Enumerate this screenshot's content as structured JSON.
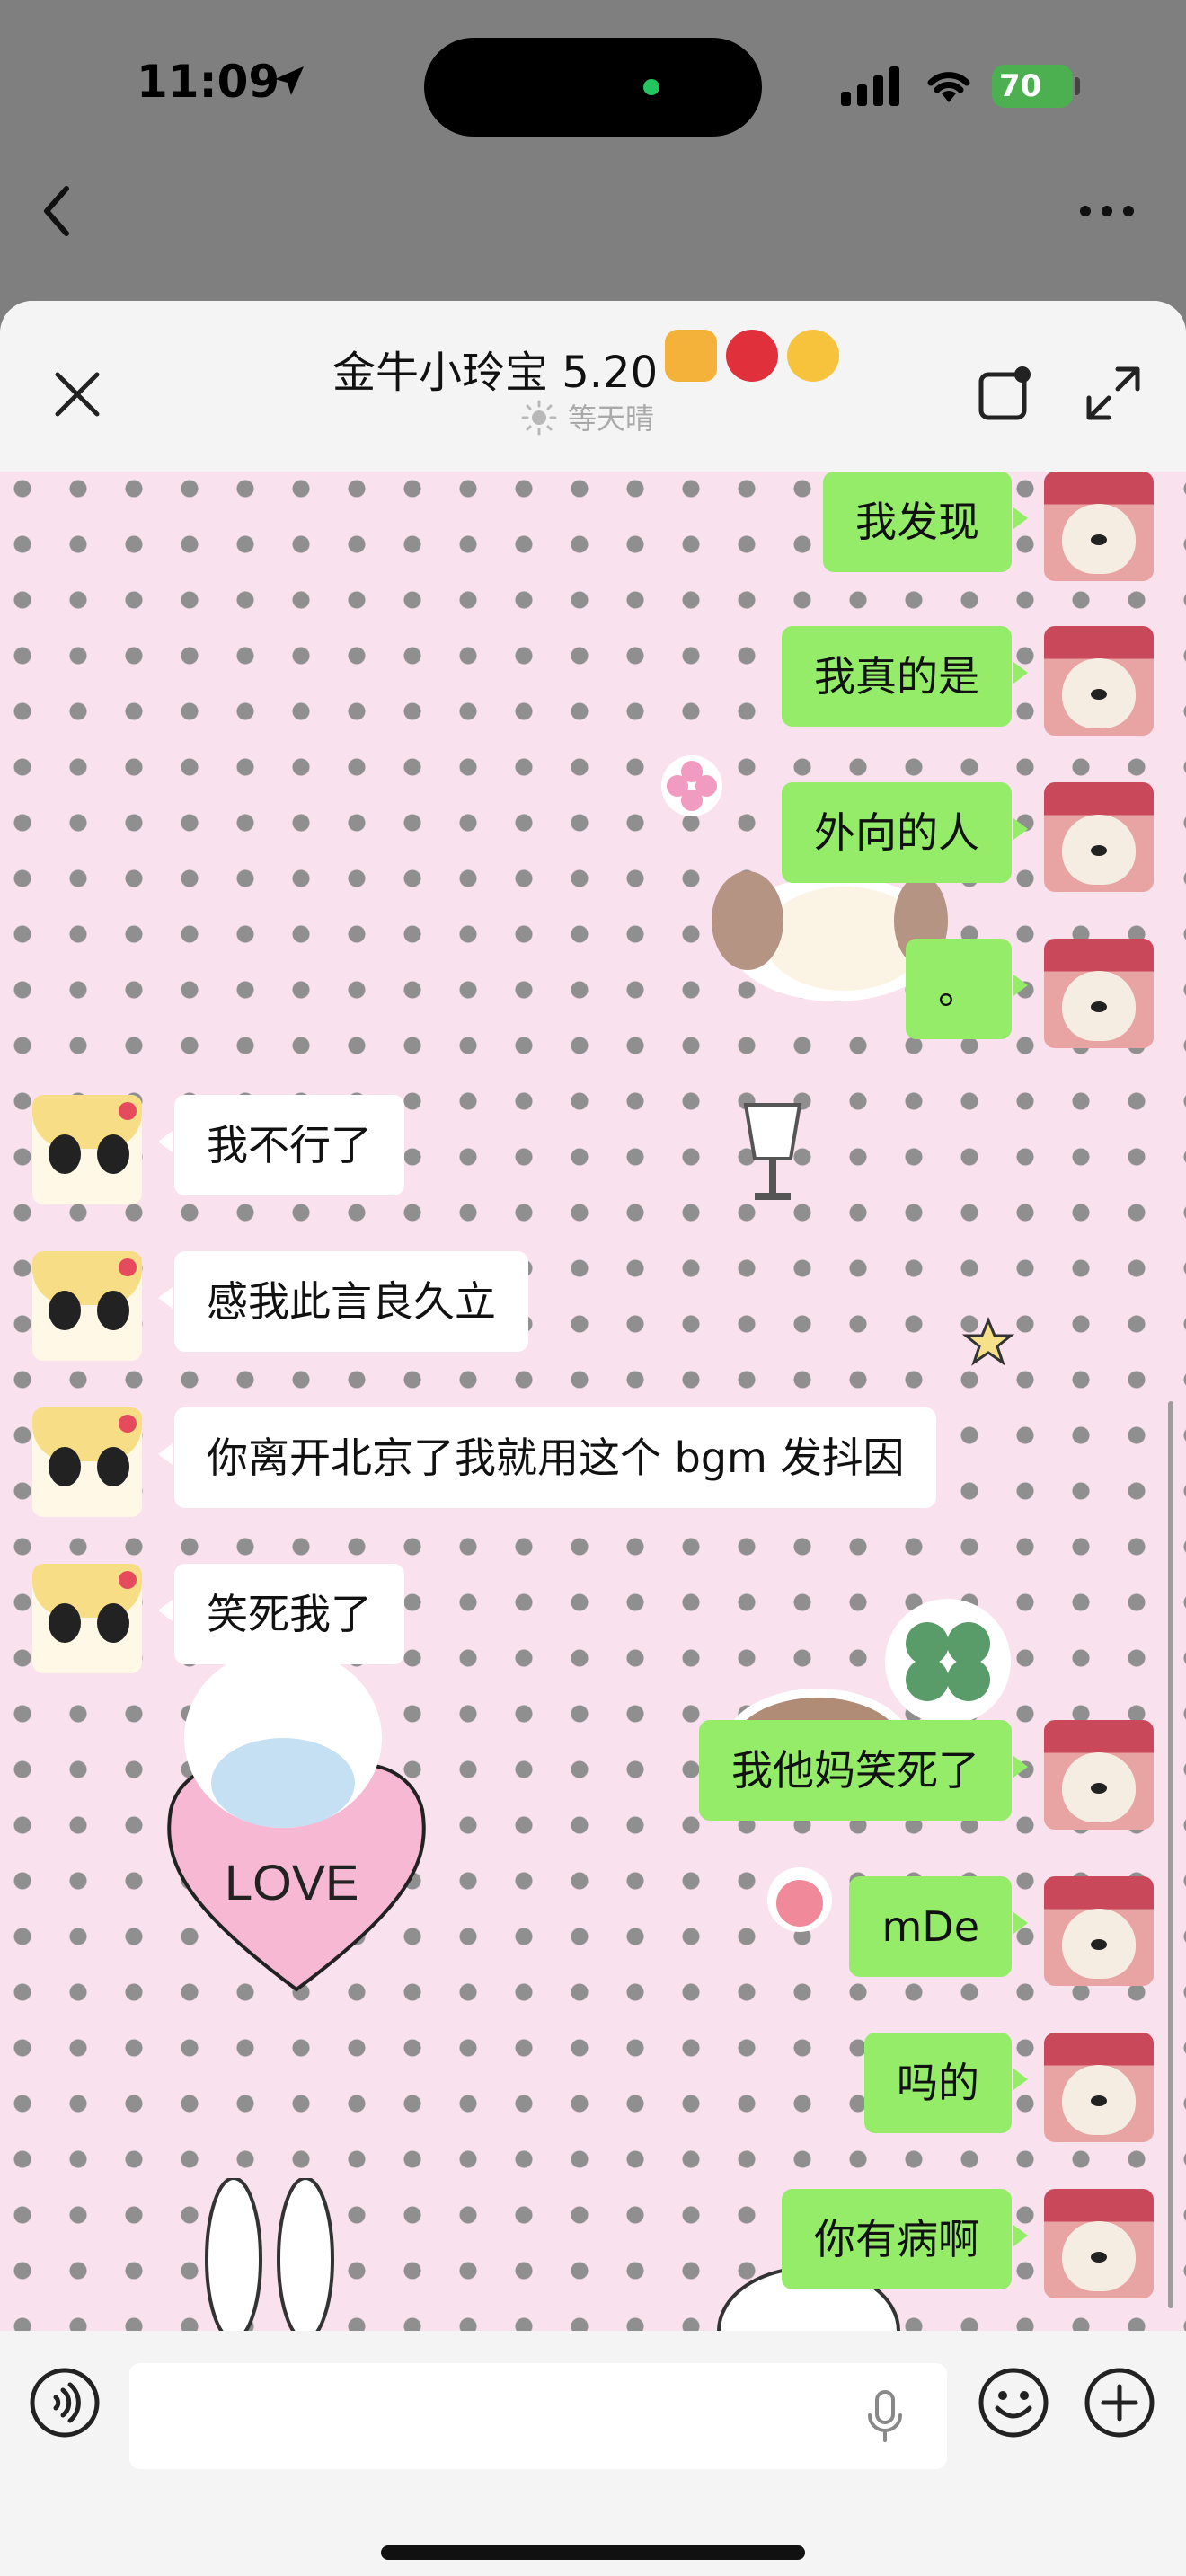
{
  "status_bar": {
    "time": "11:09",
    "battery": "70"
  },
  "header": {
    "title": "金牛小玲宝 5.20",
    "subtitle": "等天晴"
  },
  "messages": [
    {
      "dir": "out",
      "text": "我发现"
    },
    {
      "dir": "out",
      "text": "我真的是"
    },
    {
      "dir": "out",
      "text": "外向的人"
    },
    {
      "dir": "out",
      "text": "。"
    },
    {
      "dir": "in",
      "text": "我不行了"
    },
    {
      "dir": "in",
      "text": "感我此言良久立"
    },
    {
      "dir": "in",
      "text": "你离开北京了我就用这个 bgm 发抖因"
    },
    {
      "dir": "in",
      "text": "笑死我了"
    },
    {
      "dir": "out",
      "text": "我他妈笑死了"
    },
    {
      "dir": "out",
      "text": "mDe"
    },
    {
      "dir": "out",
      "text": "吗的"
    },
    {
      "dir": "out",
      "text": "你有病啊"
    }
  ],
  "sticker_text": {
    "love": "LOVE"
  },
  "colors": {
    "outgoing_bubble": "#95ec69",
    "incoming_bubble": "#ffffff",
    "chat_background": "#f9e1ee"
  },
  "icons": {
    "back": "chevron-left-icon",
    "more": "more-horizontal-icon",
    "close": "close-icon",
    "minimize": "floating-window-icon",
    "expand": "expand-icon",
    "voice": "voice-icon",
    "mic": "mic-icon",
    "emoji": "emoji-icon",
    "plus": "plus-icon"
  }
}
